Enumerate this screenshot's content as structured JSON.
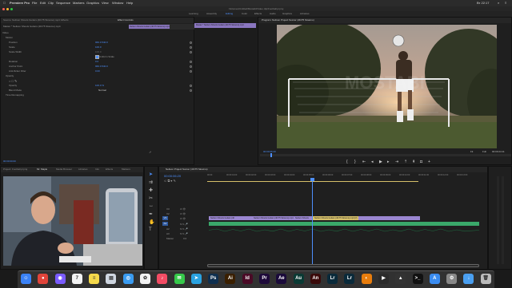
{
  "menubar": {
    "apple": "",
    "app_name": "Premiere Pro",
    "items": [
      "File",
      "Edit",
      "Clip",
      "Sequence",
      "Markers",
      "Graphics",
      "View",
      "Window",
      "Help"
    ],
    "clock": "Вт 22:17"
  },
  "window": {
    "title": "/Volumes/Untitled/Mostabi/Video clip/Football.prproj"
  },
  "workspaces": {
    "items": [
      "Learning",
      "Assembly",
      "Editing",
      "Color",
      "Effects",
      "Audio",
      "Graphics",
      "Libraries"
    ],
    "active_index": 2
  },
  "source_panel": {
    "tabs": [
      "Source: Neilson Shoots Guitars (4K/75 Slowmo).mp4: Effects",
      "Effect Controls",
      "Audio Clip Mixer: Neilson Shoots Guitars (4K/75 Slowmo)",
      "Metadata"
    ],
    "active_tab": 1,
    "clip_header": "Master * Neilson Shoots Guitars (4K/75 Slowmo).mp4",
    "sequence_header": "Neilson Shoots Guitars (4K/75 Slowmo).mp4",
    "section_video": "Video",
    "rows": [
      {
        "label": "Motion",
        "value": ""
      },
      {
        "label": "Position",
        "value": "960.0   540.0"
      },
      {
        "label": "Scale",
        "value": "100.0"
      },
      {
        "label": "Scale Width",
        "value": "100.0"
      },
      {
        "label": "",
        "value": "Uniform Scale"
      },
      {
        "label": "Rotation",
        "value": "0.0"
      },
      {
        "label": "Anchor Point",
        "value": "960.0   540.0"
      },
      {
        "label": "Anti-flicker Filter",
        "value": "0.00"
      },
      {
        "label": "Opacity",
        "value": ""
      },
      {
        "label": "Opacity",
        "value": "100.0 %"
      },
      {
        "label": "Blend Mode",
        "value": "Normal"
      },
      {
        "label": "Time Remapping",
        "value": ""
      }
    ],
    "timecode_mini": "00:00:00:00"
  },
  "program_monitor": {
    "tab": "Program: Neilson Project Soccer (4K/75 Slowmo)",
    "timecode_left": "00:00:06:20",
    "fit": "Fit",
    "quality": "Full",
    "timecode_right": "00:00:24:11"
  },
  "project_panel": {
    "tabs": [
      "Project: Football.prproj",
      "Mr. Maple",
      "Media Browser",
      "Libraries",
      "Info",
      "Effects",
      "Markers"
    ],
    "active_tab": 1
  },
  "timeline": {
    "tab": "Neilson Project Soccer (4K/75 Slowmo)",
    "timecode": "00:00:06:20",
    "ruler": [
      "00:00",
      "00:00:01:00",
      "00:00:02:00",
      "00:00:03:00",
      "00:00:04:00",
      "00:00:05:00",
      "00:00:06:00",
      "00:00:07:00",
      "00:00:08:00",
      "00:00:09:00",
      "00:00:10:00",
      "00:00:11:00",
      "00:00:12:00",
      "00:00:13:00",
      "00:00:14:00"
    ],
    "tracks": [
      "V3",
      "V2",
      "V1",
      "A1",
      "A2",
      "A3"
    ],
    "master": "Master",
    "master_value": "0.0",
    "clips_v1": [
      {
        "label": "Neilson Shoots Guitars (4K",
        "color": "#9a86d0"
      },
      {
        "label": "Neilson Shoots Guitars (4K/75 Slowmo).mp4",
        "color": "#9a86d0"
      },
      {
        "label": "Neilson Shoots",
        "color": "#9a86d0"
      },
      {
        "label": "Neilson Shoots Guitars (4K/75 Slowmo).mp4 [V]",
        "color": "#d6c06a"
      }
    ],
    "clips_a1": [
      {
        "label": "",
        "color": "#3aa86a"
      }
    ]
  },
  "dock": {
    "apps": [
      {
        "name": "Finder",
        "glyph": "☺",
        "color": "#3b82f6"
      },
      {
        "name": "Chrome",
        "glyph": "●",
        "color": "#e0443a"
      },
      {
        "name": "Siri",
        "glyph": "◉",
        "color": "#7b5cff"
      },
      {
        "name": "Calendar",
        "glyph": "7",
        "color": "#f2f2f2"
      },
      {
        "name": "Notes",
        "glyph": "≡",
        "color": "#f5d94a"
      },
      {
        "name": "Preview",
        "glyph": "▤",
        "color": "#cfd6e0"
      },
      {
        "name": "Safari",
        "glyph": "◎",
        "color": "#3a9bf0"
      },
      {
        "name": "Photos",
        "glyph": "✿",
        "color": "#f2f2f2"
      },
      {
        "name": "Music",
        "glyph": "♪",
        "color": "#f34c64"
      },
      {
        "name": "Messages",
        "glyph": "✉",
        "color": "#36c84a"
      },
      {
        "name": "Telegram",
        "glyph": "➤",
        "color": "#2aa2e0"
      },
      {
        "name": "Photoshop",
        "glyph": "Ps",
        "color": "#0f2f4f"
      },
      {
        "name": "Illustrator",
        "glyph": "Ai",
        "color": "#3a1f00"
      },
      {
        "name": "InDesign",
        "glyph": "Id",
        "color": "#4a0a26"
      },
      {
        "name": "Premiere Pro",
        "glyph": "Pr",
        "color": "#1e0a3a"
      },
      {
        "name": "After Effects",
        "glyph": "Ae",
        "color": "#1a0a3a"
      },
      {
        "name": "Audition",
        "glyph": "Au",
        "color": "#0a3a34"
      },
      {
        "name": "Animate",
        "glyph": "An",
        "color": "#3a0a0a"
      },
      {
        "name": "Lightroom Classic",
        "glyph": "Lr",
        "color": "#0a2a3a"
      },
      {
        "name": "Lightroom",
        "glyph": "Lr",
        "color": "#0a2a3a"
      },
      {
        "name": "Blender",
        "glyph": "◐",
        "color": "#e87d0d"
      },
      {
        "name": "Final Cut Pro",
        "glyph": "▶",
        "color": "#2b2b2b"
      },
      {
        "name": "Compressor",
        "glyph": "▲",
        "color": "#333"
      },
      {
        "name": "Terminal",
        "glyph": ">_",
        "color": "#111"
      },
      {
        "name": "App Store",
        "glyph": "A",
        "color": "#3a8cf0"
      },
      {
        "name": "System Preferences",
        "glyph": "⚙",
        "color": "#888"
      },
      {
        "name": "Downloads",
        "glyph": "↓",
        "color": "#4a9ff0"
      },
      {
        "name": "Trash",
        "glyph": "🗑",
        "color": "#bbb"
      }
    ]
  }
}
